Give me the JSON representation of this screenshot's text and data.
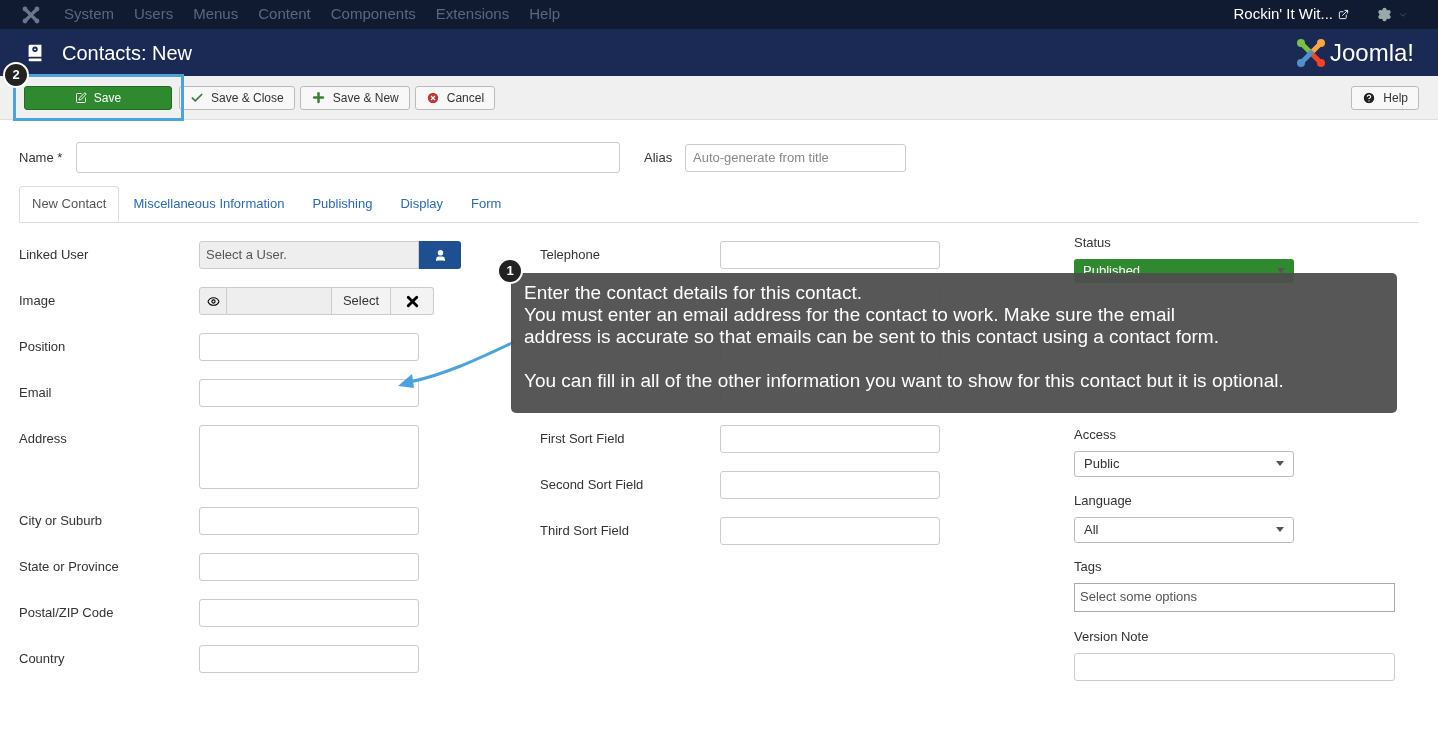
{
  "topmenu": {
    "items": [
      "System",
      "Users",
      "Menus",
      "Content",
      "Components",
      "Extensions",
      "Help"
    ],
    "site_link": "Rockin' It Wit..."
  },
  "header": {
    "title": "Contacts: New",
    "logo_text": "Joomla!"
  },
  "toolbar": {
    "buttons": [
      {
        "label": "Save",
        "kind": "primary"
      },
      {
        "label": "Save & Close",
        "kind": "check"
      },
      {
        "label": "Save & New",
        "kind": "plus"
      },
      {
        "label": "Cancel",
        "kind": "cancel"
      }
    ],
    "help": "Help"
  },
  "name": {
    "label": "Name *"
  },
  "alias": {
    "label": "Alias",
    "placeholder": "Auto-generate from title"
  },
  "tabs": [
    {
      "label": "New Contact",
      "selected": true
    },
    {
      "label": "Miscellaneous Information",
      "selected": false
    },
    {
      "label": "Publishing",
      "selected": false
    },
    {
      "label": "Display",
      "selected": false
    },
    {
      "label": "Form",
      "selected": false
    }
  ],
  "left_fields": [
    {
      "label": "Linked User",
      "kind": "user",
      "value": "Select a User."
    },
    {
      "label": "Image",
      "kind": "media",
      "button": "Select"
    },
    {
      "label": "Position",
      "kind": "text"
    },
    {
      "label": "Email",
      "kind": "text"
    },
    {
      "label": "Address",
      "kind": "textarea"
    },
    {
      "label": "City or Suburb",
      "kind": "text"
    },
    {
      "label": "State or Province",
      "kind": "text"
    },
    {
      "label": "Postal/ZIP Code",
      "kind": "text"
    },
    {
      "label": "Country",
      "kind": "text"
    }
  ],
  "middle_fields": [
    {
      "label": "Telephone",
      "kind": "text"
    },
    {
      "kind": "covered"
    },
    {
      "kind": "covered"
    },
    {
      "kind": "covered"
    },
    {
      "label": "First Sort Field",
      "kind": "text"
    },
    {
      "label": "Second Sort Field",
      "kind": "text"
    },
    {
      "label": "Third Sort Field",
      "kind": "text"
    }
  ],
  "right_fields": [
    {
      "label": "Status",
      "kind": "status",
      "value": "Published"
    },
    {
      "kind": "covered"
    },
    {
      "label": "Access",
      "kind": "select",
      "value": "Public"
    },
    {
      "label": "Language",
      "kind": "select",
      "value": "All"
    },
    {
      "label": "Tags",
      "kind": "tags",
      "placeholder": "Select some options"
    },
    {
      "label": "Version Note",
      "kind": "text"
    }
  ],
  "callouts": [
    {
      "number": "1",
      "paragraphs": [
        "Enter the contact details for this contact.\nYou must enter an email address for the contact to work. Make sure the email\naddress is accurate so that emails can be sent to this contact using a contact form.",
        "You can fill in all of the other information you want to show for this contact but it is optional."
      ]
    },
    {
      "number": "2"
    }
  ]
}
